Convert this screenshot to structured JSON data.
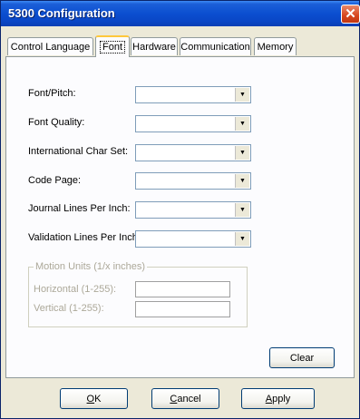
{
  "window": {
    "title": "5300 Configuration",
    "close_glyph": "✕"
  },
  "tabs": [
    {
      "label": "Control Language"
    },
    {
      "label": "Font",
      "active": true
    },
    {
      "label": "Hardware"
    },
    {
      "label": "Communication"
    },
    {
      "label": "Memory"
    }
  ],
  "fields": {
    "font_pitch": {
      "label": "Font/Pitch:",
      "value": ""
    },
    "font_quality": {
      "label": "Font Quality:",
      "value": ""
    },
    "intl_char_set": {
      "label": "International Char Set:",
      "value": ""
    },
    "code_page": {
      "label": "Code Page:",
      "value": ""
    },
    "journal_lpi": {
      "label": "Journal Lines Per Inch:",
      "value": ""
    },
    "validation_lpi": {
      "label": "Validation Lines Per Inch:",
      "value": ""
    }
  },
  "motion_units": {
    "legend": "Motion Units (1/x inches)",
    "horizontal_label": "Horizontal (1-255):",
    "horizontal_value": "",
    "vertical_label": "Vertical (1-255):",
    "vertical_value": ""
  },
  "buttons": {
    "clear": "Clear",
    "ok_mnemonic": "O",
    "ok_rest": "K",
    "cancel_mnemonic": "C",
    "cancel_rest": "ancel",
    "apply_mnemonic": "A",
    "apply_rest": "pply"
  },
  "icons": {
    "dropdown": "dropdown-arrow-icon",
    "close": "close-icon"
  },
  "colors": {
    "titlebar": "#0b4fd0",
    "window_bg": "#ece9d8",
    "panel_bg": "#fcfcfe",
    "close_button": "#d7461e",
    "active_tab_accent": "#ffc83c"
  }
}
